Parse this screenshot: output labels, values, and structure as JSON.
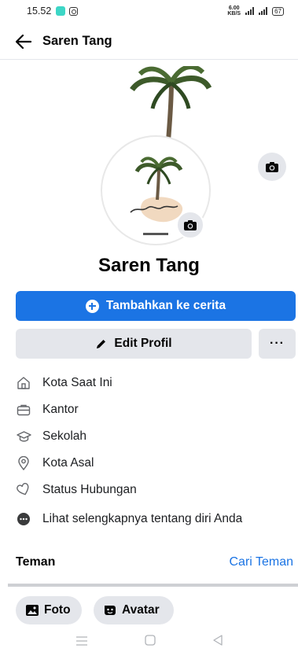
{
  "status_bar": {
    "time": "15.52",
    "net_speed_value": "6.00",
    "net_speed_unit": "KB/S",
    "battery": "67"
  },
  "header": {
    "title": "Saren Tang"
  },
  "profile": {
    "name": "Saren Tang"
  },
  "actions": {
    "add_story_label": "Tambahkan ke cerita",
    "edit_profile_label": "Edit Profil",
    "more_label": "···"
  },
  "info": {
    "items": [
      {
        "label": "Kota Saat Ini",
        "icon": "home-icon"
      },
      {
        "label": "Kantor",
        "icon": "briefcase-icon"
      },
      {
        "label": "Sekolah",
        "icon": "graduation-cap-icon"
      },
      {
        "label": "Kota Asal",
        "icon": "location-pin-icon"
      },
      {
        "label": "Status Hubungan",
        "icon": "heart-icon"
      }
    ],
    "see_more_label": "Lihat selengkapnya tentang diri Anda"
  },
  "friends": {
    "title": "Teman",
    "find_label": "Cari Teman"
  },
  "chips": {
    "photo_label": "Foto",
    "avatar_label": "Avatar"
  },
  "colors": {
    "accent": "#1b74e4",
    "button_gray": "#e4e6eb"
  }
}
